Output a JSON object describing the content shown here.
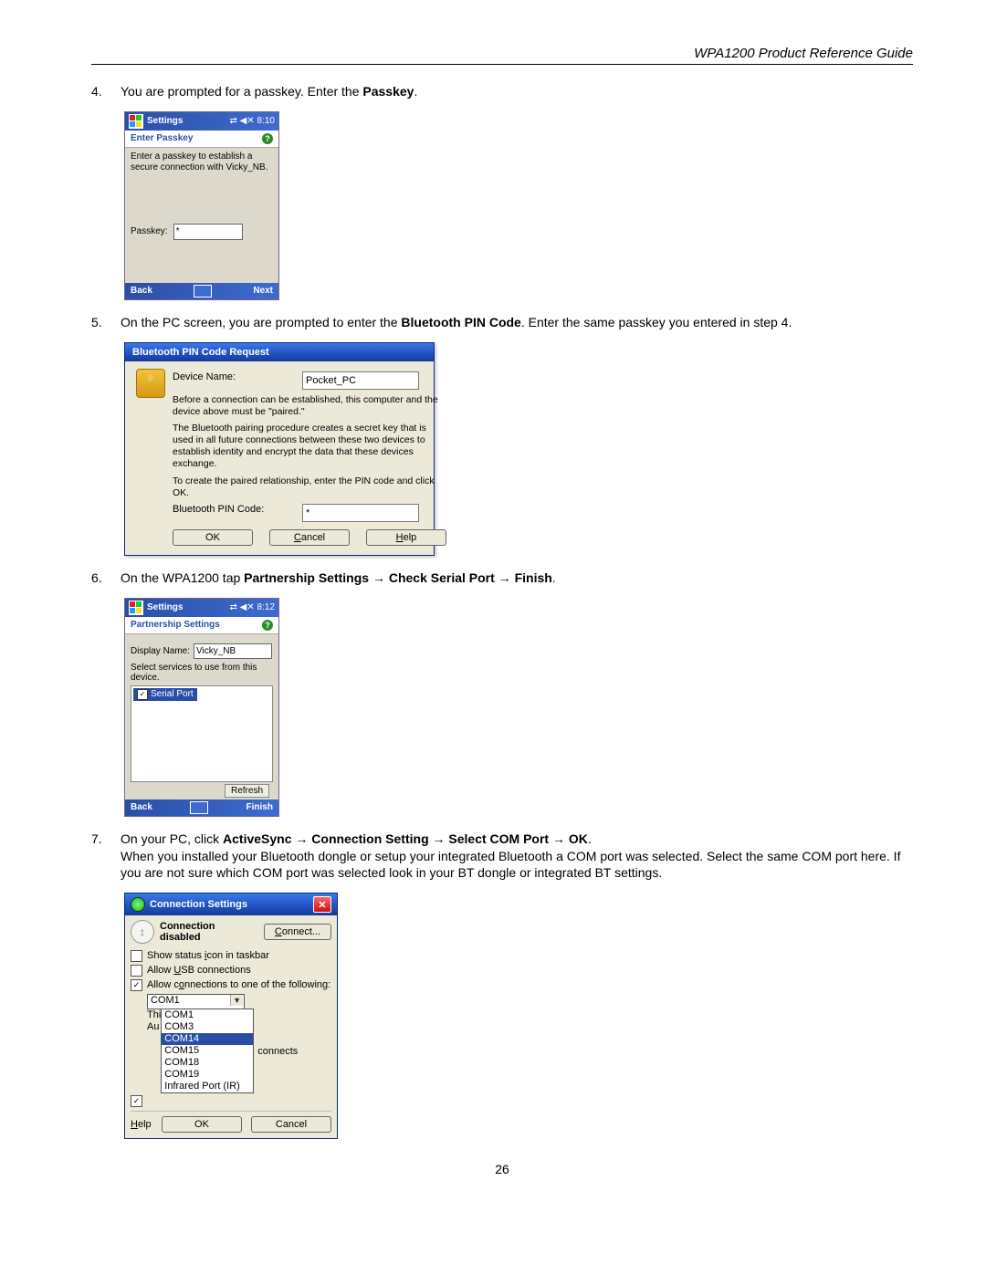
{
  "doc_title": "WPA1200 Product Reference Guide",
  "page_number": "26",
  "steps": {
    "s4": {
      "num": "4.",
      "text_a": "You are prompted for a passkey. Enter the ",
      "bold": "Passkey",
      "text_b": "."
    },
    "s5": {
      "num": "5.",
      "text_a": "On the PC screen, you are prompted to enter the ",
      "bold": "Bluetooth PIN Code",
      "text_b": ".  Enter the same passkey you entered in step 4."
    },
    "s6": {
      "num": "6.",
      "text_a": "On the WPA1200 tap ",
      "bold": "Partnership Settings → Check Serial Port → Finish",
      "text_b": "."
    },
    "s7": {
      "num": "7.",
      "text_a": "On your PC, click ",
      "bold": "ActiveSync → Connection Setting → Select COM Port → OK",
      "text_b": ".",
      "extra": "When you installed your Bluetooth dongle or setup your integrated Bluetooth a COM port was selected. Select the same COM port here. If you are not sure which COM port was selected look in your BT dongle or integrated BT settings."
    }
  },
  "ppc1": {
    "app": "Settings",
    "time": "8:10",
    "subtitle": "Enter Passkey",
    "msg": "Enter a passkey to establish a secure connection with Vicky_NB.",
    "passkey_label": "Passkey:",
    "passkey_value": "*",
    "back": "Back",
    "next": "Next"
  },
  "ppc2": {
    "app": "Settings",
    "time": "8:12",
    "subtitle": "Partnership Settings",
    "display_label": "Display Name:",
    "display_value": "Vicky_NB",
    "svc_label": "Select services to use from this device.",
    "svc_item": "Serial Port",
    "refresh": "Refresh",
    "back": "Back",
    "finish": "Finish"
  },
  "pin": {
    "title": "Bluetooth PIN Code Request",
    "device_label": "Device Name:",
    "device_value": "Pocket_PC",
    "p1": "Before a connection can be established, this computer and the device above must be \"paired.\"",
    "p2": "The Bluetooth pairing procedure creates a secret key that is used in all future connections between these two devices to establish identity and encrypt the data that these devices exchange.",
    "p3": "To create the paired relationship, enter the PIN code and click OK.",
    "code_label": "Bluetooth PIN Code:",
    "code_value": "*",
    "ok": "OK",
    "cancel": "Cancel",
    "help": "Help"
  },
  "conn": {
    "title": "Connection Settings",
    "status": "Connection disabled",
    "connect_btn": "Connect...",
    "chk_taskbar": "Show status icon in taskbar",
    "chk_usb": "Allow USB connections",
    "chk_allow": "Allow connections to one of the following:",
    "combo_sel": "COM1",
    "list": [
      "COM1",
      "COM3",
      "COM14",
      "COM15",
      "COM18",
      "COM19",
      "Infrared Port (IR)"
    ],
    "list_selected": "COM14",
    "side_prefix_thi": "Thi",
    "side_prefix_au": "Au",
    "side_connects": "connects",
    "help": "Help",
    "ok": "OK",
    "cancel": "Cancel"
  }
}
